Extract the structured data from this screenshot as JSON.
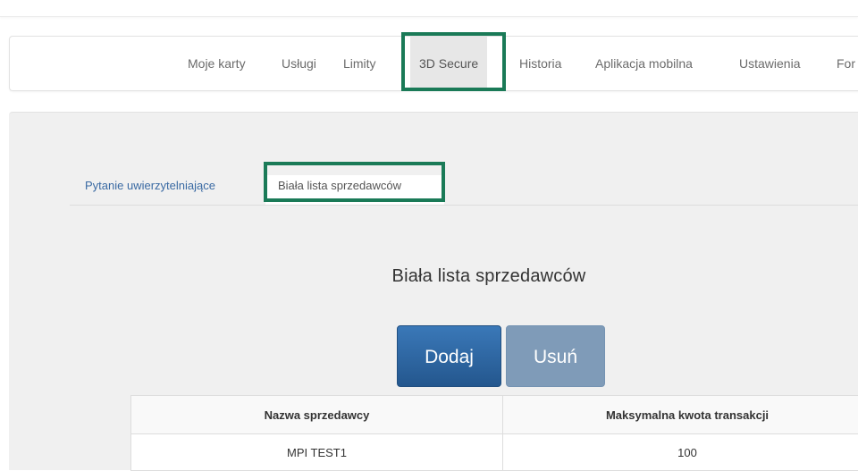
{
  "nav": {
    "items": [
      {
        "label": "Moje karty"
      },
      {
        "label": "Usługi"
      },
      {
        "label": "Limity"
      },
      {
        "label": "3D Secure"
      },
      {
        "label": "Historia"
      },
      {
        "label": "Aplikacja mobilna"
      },
      {
        "label": "Ustawienia"
      },
      {
        "label": "For"
      }
    ],
    "active_index": 3
  },
  "tabs": [
    {
      "label": "Pytanie uwierzytelniające"
    },
    {
      "label": "Biała lista sprzedawców"
    }
  ],
  "section": {
    "title": "Biała lista sprzedawców"
  },
  "buttons": {
    "add": "Dodaj",
    "remove": "Usuń"
  },
  "table": {
    "headers": [
      "Nazwa sprzedawcy",
      "Maksymalna kwota transakcji"
    ],
    "rows": [
      [
        "MPI TEST1",
        "100"
      ]
    ]
  },
  "colors": {
    "highlight": "#1a7a57",
    "primary": "#2d6aa8",
    "link": "#3a6aa3"
  }
}
